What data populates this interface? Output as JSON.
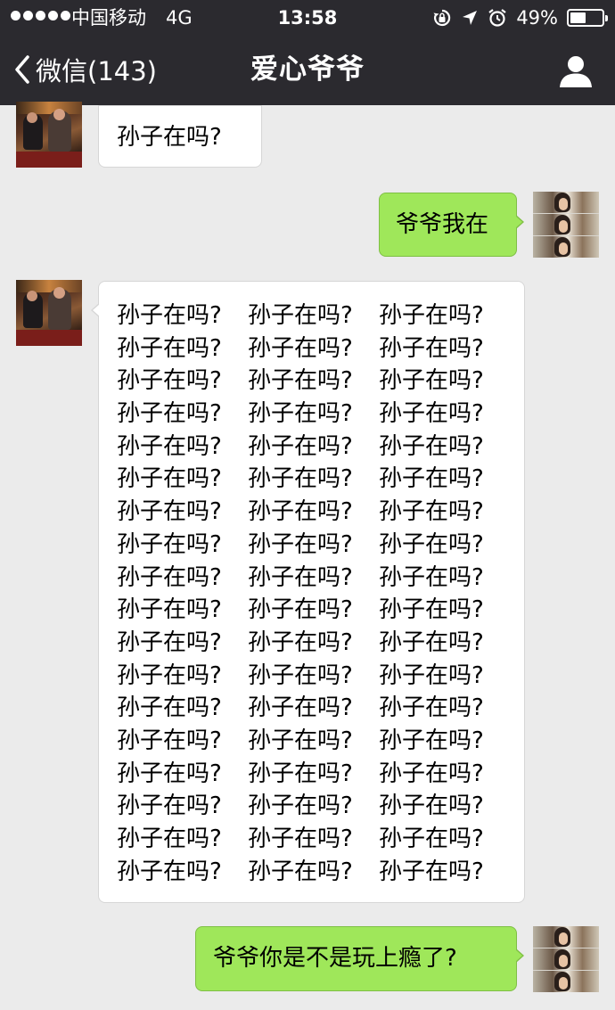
{
  "status_bar": {
    "carrier": "中国移动",
    "network": "4G",
    "time": "13:58",
    "battery_percent": "49%",
    "battery_level": 0.49,
    "icons": [
      "signal-dots-icon",
      "rotation-lock-icon",
      "location-arrow-icon",
      "alarm-icon",
      "battery-icon"
    ]
  },
  "nav": {
    "back_label": "微信(143)",
    "title": "爱心爷爷",
    "back_icon": "chevron-left-icon",
    "profile_icon": "person-icon"
  },
  "colors": {
    "nav_background": "#2b2a2f",
    "chat_background": "#ebebeb",
    "sent_bubble": "#9fe75a",
    "received_bubble": "#ffffff"
  },
  "messages": [
    {
      "sender": "other",
      "text": "孙子在吗?"
    },
    {
      "sender": "me",
      "text": "爷爷我在"
    },
    {
      "sender": "other",
      "lines": [
        [
          "孙子在吗?",
          "孙子在吗?",
          "孙子在吗?"
        ],
        [
          "孙子在吗?",
          "孙子在吗?",
          "孙子在吗?"
        ],
        [
          "孙子在吗?",
          "孙子在吗?",
          "孙子在吗?"
        ],
        [
          "孙子在吗?",
          "孙子在吗?",
          "孙子在吗?"
        ],
        [
          "孙子在吗?",
          "孙子在吗?",
          "孙子在吗?"
        ],
        [
          "孙子在吗?",
          "孙子在吗?",
          "孙子在吗?"
        ],
        [
          "孙子在吗?",
          "孙子在吗?",
          "孙子在吗?"
        ],
        [
          "孙子在吗?",
          "孙子在吗?",
          "孙子在吗?"
        ],
        [
          "孙子在吗?",
          "孙子在吗?",
          "孙子在吗?"
        ],
        [
          "孙子在吗?",
          "孙子在吗?",
          "孙子在吗?"
        ],
        [
          "孙子在吗?",
          "孙子在吗?",
          "孙子在吗?"
        ],
        [
          "孙子在吗?",
          "孙子在吗?",
          "孙子在吗?"
        ],
        [
          "孙子在吗?",
          "孙子在吗?",
          "孙子在吗?"
        ],
        [
          "孙子在吗?",
          "孙子在吗?",
          "孙子在吗?"
        ],
        [
          "孙子在吗?",
          "孙子在吗?",
          "孙子在吗?"
        ],
        [
          "孙子在吗?",
          "孙子在吗?",
          "孙子在吗?"
        ],
        [
          "孙子在吗?",
          "孙子在吗?",
          "孙子在吗?"
        ],
        [
          "孙子在吗?",
          "孙子在吗?",
          "孙子在吗?"
        ]
      ]
    },
    {
      "sender": "me",
      "text": "爷爷你是不是玩上瘾了?"
    }
  ]
}
